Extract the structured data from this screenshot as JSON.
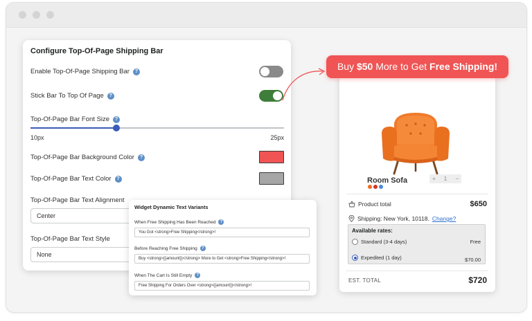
{
  "settings": {
    "title": "Configure Top-Of-Page Shipping Bar",
    "enable_label": "Enable Top-Of-Page Shipping Bar",
    "enable_on": false,
    "stick_label": "Stick Bar To Top Of Page",
    "stick_on": true,
    "font_size_label": "Top-Of-Page Bar Font Size",
    "font_size_min": "10px",
    "font_size_max": "25px",
    "bg_color_label": "Top-Of-Page Bar Background Color",
    "bg_color": "#f05454",
    "text_color_label": "Top-Of-Page Bar Text Color",
    "text_color": "#a6a6a6",
    "alignment_label": "Top-Of-Page Bar Text Alignment",
    "alignment_value": "Center",
    "style_label": "Top-Of-Page Bar Text Style",
    "style_value": "None"
  },
  "variants": {
    "title": "Widget Dynamic Text Variants",
    "reached_label": "When Free Shipping Has Been Reached",
    "reached_value": "You Got <strong>Free Shipping</strong>!",
    "before_label": "Before Reaching Free Shipping",
    "before_value": "Buy <strong>{{amount}}</strong> More to Get <strong>Free Shipping</strong>!",
    "empty_label": "When The Cart Is Still Empty",
    "empty_value": "Free Shipping For Orders Over <strong>{{amount}}</strong>!"
  },
  "banner": {
    "pre": "Buy ",
    "amount": "$50",
    "mid": " More to Get ",
    "goal": "Free Shipping!"
  },
  "cart": {
    "product_name": "Room Sofa",
    "qty": "1",
    "qty_minus": "−",
    "qty_plus": "+",
    "product_total_label": "Product total",
    "product_total": "$650",
    "shipping_label": "Shipping: New York, 10118.",
    "change_link": "Change?",
    "rates_title": "Available rates:",
    "rates": [
      {
        "label": "Standard (3-4 days)",
        "price": "Free",
        "selected": false
      },
      {
        "label": "Expedited (1 day)",
        "price": "$70.00",
        "selected": true
      }
    ],
    "est_total_label": "EST. TOTAL",
    "est_total": "$720",
    "color_options": [
      "#f26b21",
      "#d93025",
      "#4a8bd6"
    ]
  },
  "colors": {
    "accent": "#3a5bb7",
    "toggle_on": "#3f7d3a",
    "toggle_off": "#8a8a8a",
    "banner": "#f05454"
  }
}
